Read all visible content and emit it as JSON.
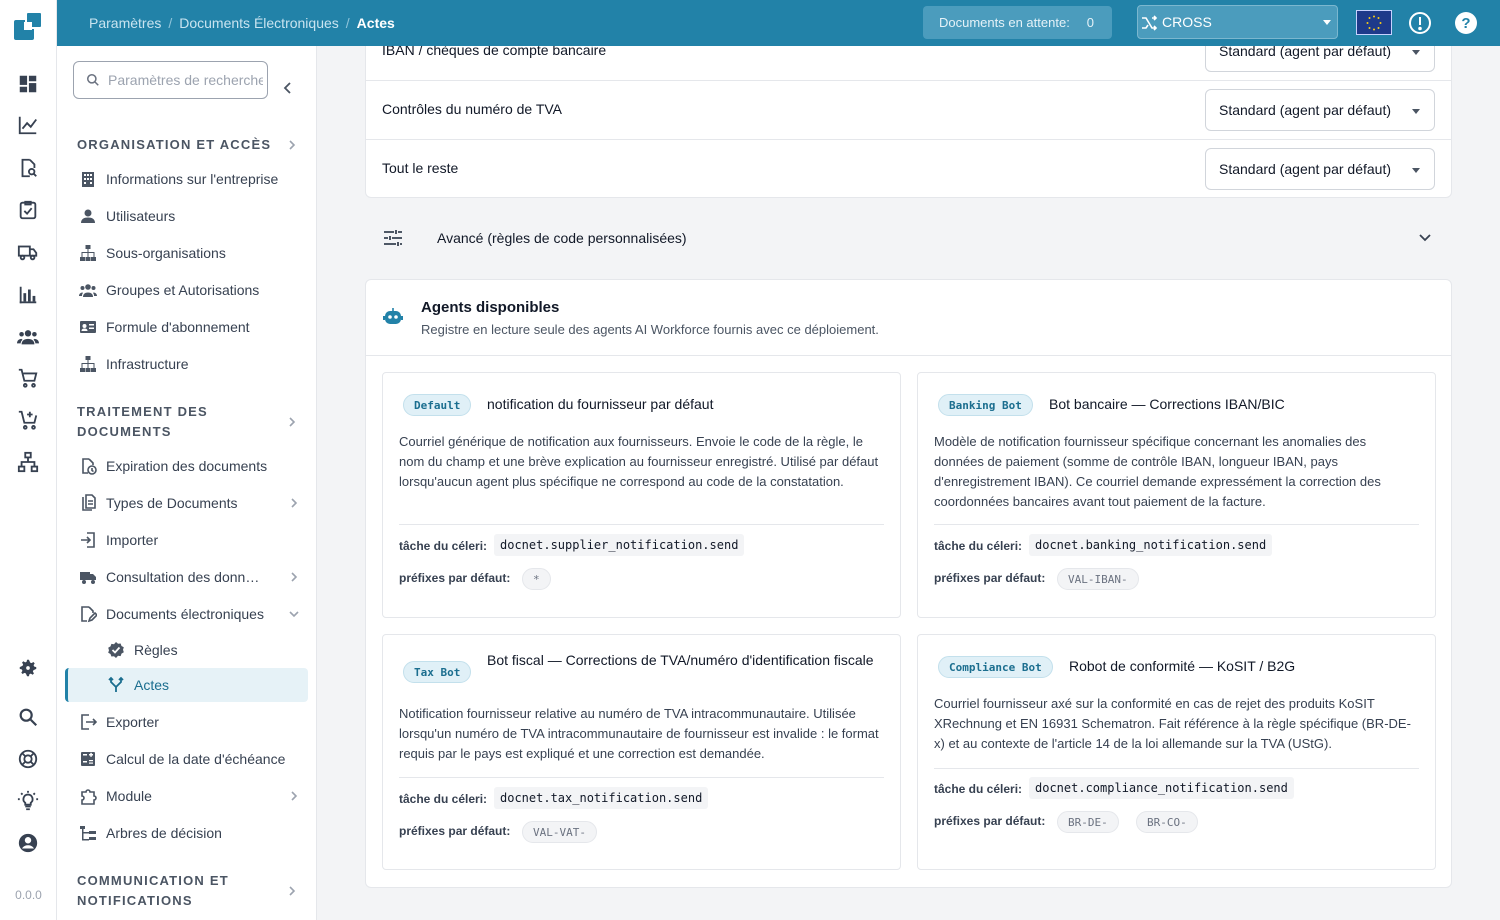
{
  "app": {
    "version": "0.0.0"
  },
  "rail": {
    "top_icons": [
      "dashboard-icon",
      "analytics-icon",
      "document-search-icon",
      "task-checklist-icon",
      "delivery-truck-icon",
      "bar-chart-icon",
      "people-icon",
      "shopping-cart-icon",
      "add-cart-icon",
      "network-icon"
    ],
    "bottom_icons": [
      "settings-icon",
      "search-icon",
      "support-icon",
      "lightbulb-icon",
      "account-icon"
    ]
  },
  "topbar": {
    "breadcrumbs": [
      "Paramètres",
      "Documents Électroniques",
      "Actes"
    ],
    "pending_label": "Documents en attente:",
    "pending_count": "0",
    "tenant": "CROSS",
    "accent": "#2282a8"
  },
  "sidebar": {
    "search_placeholder": "Paramètres de recherche",
    "sections": [
      {
        "title": "Organisation et accès",
        "items": [
          {
            "label": "Informations sur l'entreprise",
            "icon": "building-icon"
          },
          {
            "label": "Utilisateurs",
            "icon": "user-icon"
          },
          {
            "label": "Sous-organisations",
            "icon": "hierarchy-icon"
          },
          {
            "label": "Groupes et Autorisations",
            "icon": "group-icon"
          },
          {
            "label": "Formule d'abonnement",
            "icon": "id-card-icon"
          },
          {
            "label": "Infrastructure",
            "icon": "hierarchy-icon"
          }
        ]
      },
      {
        "title": "Traitement des documents",
        "items": [
          {
            "label": "Expiration des documents",
            "icon": "document-clock-icon"
          },
          {
            "label": "Types de Documents",
            "icon": "documents-icon"
          },
          {
            "label": "Importer",
            "icon": "import-icon"
          },
          {
            "label": "Consultation des données",
            "icon": "truck-icon"
          },
          {
            "label": "Documents électroniques",
            "icon": "document-edit-icon"
          },
          {
            "label": "Règles",
            "icon": "verified-icon"
          },
          {
            "label": "Actes",
            "icon": "fork-icon"
          },
          {
            "label": "Exporter",
            "icon": "export-icon"
          },
          {
            "label": "Calcul de la date d'échéance",
            "icon": "calculator-icon"
          },
          {
            "label": "Module",
            "icon": "puzzle-icon"
          },
          {
            "label": "Arbres de décision",
            "icon": "tree-icon"
          }
        ]
      },
      {
        "title": "Communication et notifications",
        "items": []
      }
    ]
  },
  "routing": {
    "rows": [
      {
        "label": "IBAN / chèques de compte bancaire",
        "value": "Standard (agent par défaut)"
      },
      {
        "label": "Contrôles du numéro de TVA",
        "value": "Standard (agent par défaut)"
      },
      {
        "label": "Tout le reste",
        "value": "Standard (agent par défaut)"
      }
    ],
    "advanced_label": "Avancé (règles de code personnalisées)"
  },
  "agents": {
    "title": "Agents disponibles",
    "subtitle": "Registre en lecture seule des agents AI Workforce fournis avec ce déploiement.",
    "task_label": "tâche du céleri:",
    "prefix_label": "préfixes par défaut:",
    "list": [
      {
        "badge": "Default",
        "name": "notification du fournisseur par défaut",
        "description": "Courriel générique de notification aux fournisseurs. Envoie le code de la règle, le nom du champ et une brève explication au fournisseur enregistré. Utilisé par défaut lorsqu'aucun agent plus spécifique ne correspond au code de la constatation.",
        "task": "docnet.supplier_notification.send",
        "prefixes": [
          "*"
        ]
      },
      {
        "badge": "Banking Bot",
        "name": "Bot bancaire — Corrections IBAN/BIC",
        "description": "Modèle de notification fournisseur spécifique concernant les anomalies des données de paiement (somme de contrôle IBAN, longueur IBAN, pays d'enregistrement IBAN). Ce courriel demande expressément la correction des coordonnées bancaires avant tout paiement de la facture.",
        "task": "docnet.banking_notification.send",
        "prefixes": [
          "VAL-IBAN-"
        ]
      },
      {
        "badge": "Tax Bot",
        "name": "Bot fiscal — Corrections de TVA/numéro d'identification fiscale",
        "description": "Notification fournisseur relative au numéro de TVA intracommunautaire. Utilisée lorsqu'un numéro de TVA intracommunautaire de fournisseur est invalide : le format requis par le pays est expliqué et une correction est demandée.",
        "task": "docnet.tax_notification.send",
        "prefixes": [
          "VAL-VAT-"
        ]
      },
      {
        "badge": "Compliance Bot",
        "name": "Robot de conformité — KoSIT / B2G",
        "description": "Courriel fournisseur axé sur la conformité en cas de rejet des produits KoSIT XRechnung et EN 16931 Schematron. Fait référence à la règle spécifique (BR-DE-x) et au contexte de l'article 14 de la loi allemande sur la TVA (UStG).",
        "task": "docnet.compliance_notification.send",
        "prefixes": [
          "BR-DE-",
          "BR-CO-"
        ]
      }
    ]
  }
}
